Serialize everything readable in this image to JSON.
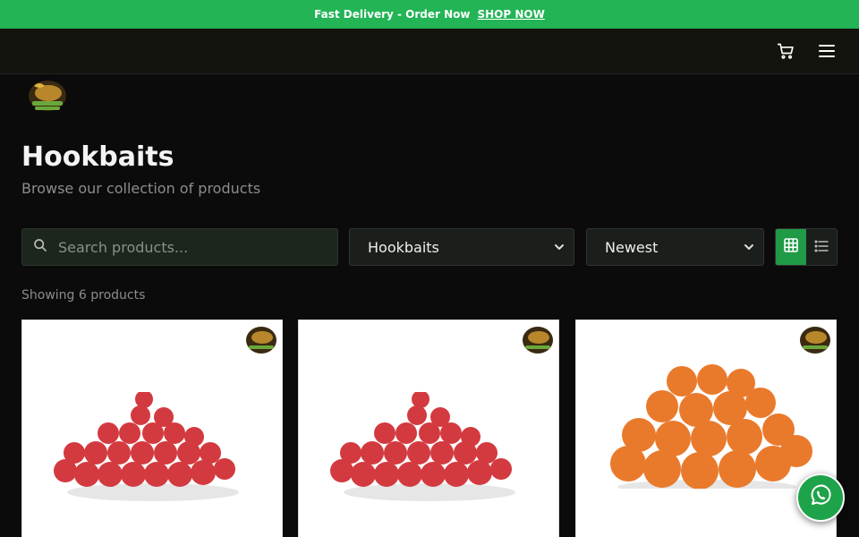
{
  "promo": {
    "text": "Fast Delivery - Order Now",
    "link": "SHOP NOW"
  },
  "header": {
    "cart_icon": "cart-icon",
    "menu_icon": "hamburger-menu-icon"
  },
  "page": {
    "title": "Hookbaits",
    "subtitle": "Browse our collection of products"
  },
  "filters": {
    "search_placeholder": "Search products...",
    "category": "Hookbaits",
    "sort": "Newest",
    "view_mode": "grid"
  },
  "results": {
    "count_text": "Showing 6 products"
  },
  "products": [
    {
      "image": "red-boilies",
      "color": "#d33a3f"
    },
    {
      "image": "red-boilies",
      "color": "#d33a3f"
    },
    {
      "image": "orange-boilies",
      "color": "#e97a2c"
    }
  ],
  "floating": {
    "whatsapp_icon": "whatsapp-icon"
  }
}
